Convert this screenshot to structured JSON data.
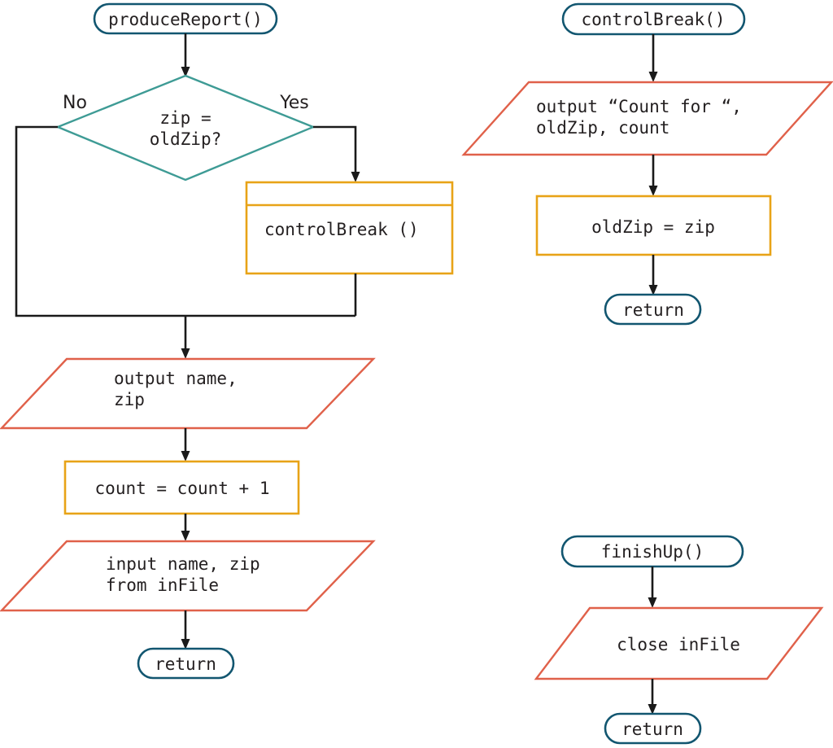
{
  "diagram": {
    "title": "Control break flowchart: produceReport, controlBreak, finishUp",
    "colors": {
      "terminator_border": "#125670",
      "decision_border": "#3E9B95",
      "io_border": "#E0614A",
      "process_border": "#E8A317",
      "connector": "#1a1a1a",
      "text": "#231f20",
      "background": "#ffffff"
    }
  },
  "flow_produce_report": {
    "start": {
      "label": "produceReport()",
      "shape": "terminator"
    },
    "decision": {
      "line1": "zip =",
      "line2": "oldZip?",
      "shape": "decision",
      "branch_no": "No",
      "branch_yes": "Yes"
    },
    "subroutine_call": {
      "label": "controlBreak ()",
      "shape": "predefined-process"
    },
    "output_name_zip": {
      "line1": "output name,",
      "line2": "zip",
      "shape": "io"
    },
    "increment_count": {
      "label": "count = count + 1",
      "shape": "process"
    },
    "input_name_zip": {
      "line1": "input name, zip",
      "line2": "from inFile",
      "shape": "io"
    },
    "end": {
      "label": "return",
      "shape": "terminator"
    }
  },
  "flow_control_break": {
    "start": {
      "label": "controlBreak()",
      "shape": "terminator"
    },
    "output_count": {
      "line1": "output “Count for “,",
      "line2": "oldZip, count",
      "shape": "io"
    },
    "assign_oldzip": {
      "label": "oldZip = zip",
      "shape": "process"
    },
    "end": {
      "label": "return",
      "shape": "terminator"
    }
  },
  "flow_finish_up": {
    "start": {
      "label": "finishUp()",
      "shape": "terminator"
    },
    "close_file": {
      "label": "close inFile",
      "shape": "io"
    },
    "end": {
      "label": "return",
      "shape": "terminator"
    }
  }
}
